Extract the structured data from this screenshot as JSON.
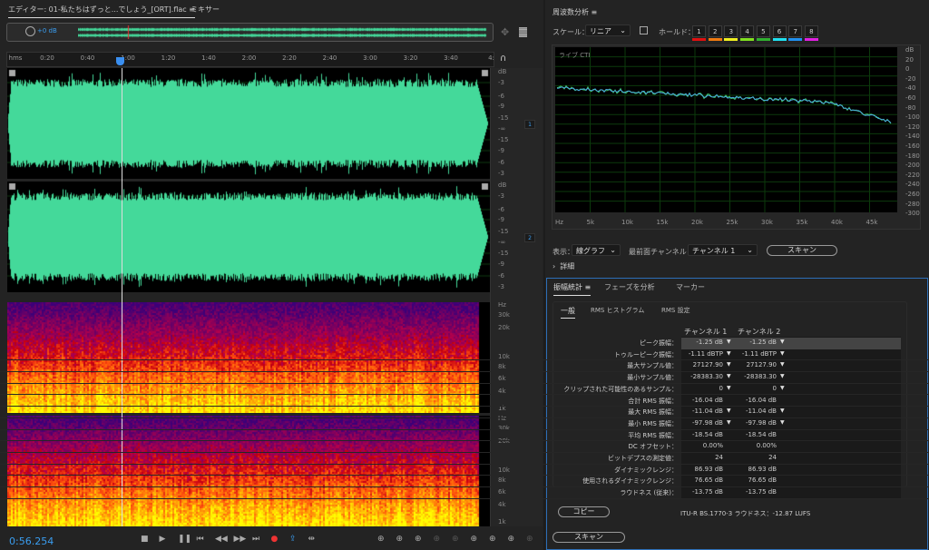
{
  "editor": {
    "tabs": [
      {
        "label": "エディター: 01-私たちはずっと...でしょう_[ORT].flac",
        "active": true
      },
      {
        "label": "ミキサー"
      }
    ],
    "menu_icon": "≡",
    "overview": {
      "gain": "+0 dB"
    },
    "ruler": {
      "unit": "hms",
      "ticks": [
        "0:20",
        "0:40",
        "1:00",
        "1:20",
        "1:40",
        "2:00",
        "2:20",
        "2:40",
        "3:00",
        "3:20",
        "3:40",
        "4:"
      ]
    },
    "playhead_time": "0:56.254",
    "wave_scale": [
      "dB",
      "-3",
      "-6",
      "-9",
      "-15",
      "-∞",
      "-15",
      "-9",
      "-6",
      "-3"
    ],
    "channels": [
      "1",
      "2"
    ],
    "spec_scale": [
      "Hz",
      "30k",
      "20k",
      "10k",
      "8k",
      "6k",
      "4k",
      "1k"
    ],
    "waveform_color": "#44d99a",
    "transport": [
      "stop-icon",
      "play-icon",
      "pause-icon",
      "go-to-start-icon",
      "rewind-icon",
      "fast-forward-icon",
      "go-to-end-icon",
      "record-icon",
      "loop-icon",
      "skip-selection-icon"
    ],
    "zoom_tools": [
      "zoom-in-amplitude-icon",
      "zoom-out-amplitude-icon",
      "zoom-in-time-icon",
      "zoom-out-full-icon",
      "zoom-selection-icon",
      "zoom-in-left-icon",
      "zoom-in-right-icon",
      "zoom-out-both-icon",
      "zoom-reset-icon"
    ]
  },
  "frequency": {
    "title": "周波数分析",
    "scale_label": "スケール：",
    "scale_value": "リニア",
    "hold_label": "ホールド：",
    "holds": [
      {
        "n": "1",
        "color": "#e01010"
      },
      {
        "n": "2",
        "color": "#f07a10"
      },
      {
        "n": "3",
        "color": "#f0f020"
      },
      {
        "n": "4",
        "color": "#80e020"
      },
      {
        "n": "5",
        "color": "#30b030"
      },
      {
        "n": "6",
        "color": "#20e0f0"
      },
      {
        "n": "7",
        "color": "#2090f0"
      },
      {
        "n": "8",
        "color": "#e020e0"
      }
    ],
    "live_label": "ライブ CTI",
    "x_ticks": [
      "Hz",
      "5k",
      "10k",
      "15k",
      "20k",
      "25k",
      "30k",
      "35k",
      "40k",
      "45k"
    ],
    "y_ticks": [
      "dB",
      "20",
      "0",
      "-20",
      "-40",
      "-60",
      "-80",
      "-100",
      "-120",
      "-140",
      "-160",
      "-180",
      "-200",
      "-220",
      "-240",
      "-260",
      "-280",
      "-300"
    ],
    "display_label": "表示：",
    "display_value": "線グラフ",
    "front_label": "最前面チャンネル：",
    "front_value": "チャンネル 1",
    "scan": "スキャン",
    "details": "詳細"
  },
  "stats": {
    "tabs": [
      "振幅統計",
      "フェーズを分析",
      "マーカー"
    ],
    "subtabs": [
      "一般",
      "RMS ヒストグラム",
      "RMS 設定"
    ],
    "headers": [
      "チャンネル 1",
      "チャンネル 2"
    ],
    "rows": [
      {
        "label": "ピーク振幅：",
        "c1": "-1.25 dB",
        "c2": "-1.25 dB",
        "flag": true
      },
      {
        "label": "トゥルーピーク振幅：",
        "c1": "-1.11 dBTP",
        "c2": "-1.11 dBTP",
        "flag": true
      },
      {
        "label": "最大サンプル値：",
        "c1": "27127.90",
        "c2": "27127.90",
        "flag": true
      },
      {
        "label": "最小サンプル値：",
        "c1": "-28383.30",
        "c2": "-28383.30",
        "flag": true
      },
      {
        "label": "クリップされた可能性のあるサンプル：",
        "c1": "0",
        "c2": "0",
        "flag": true
      },
      {
        "label": "合計 RMS 振幅：",
        "c1": "-16.04 dB",
        "c2": "-16.04 dB",
        "flag": false
      },
      {
        "label": "最大 RMS 振幅：",
        "c1": "-11.04 dB",
        "c2": "-11.04 dB",
        "flag": true
      },
      {
        "label": "最小 RMS 振幅：",
        "c1": "-97.98 dB",
        "c2": "-97.98 dB",
        "flag": true
      },
      {
        "label": "平均 RMS 振幅：",
        "c1": "-18.54 dB",
        "c2": "-18.54 dB",
        "flag": false
      },
      {
        "label": "DC オフセット：",
        "c1": "0.00%",
        "c2": "0.00%",
        "flag": false
      },
      {
        "label": "ビットデプスの測定値：",
        "c1": "24",
        "c2": "24",
        "flag": false
      },
      {
        "label": "ダイナミックレンジ：",
        "c1": "86.93 dB",
        "c2": "86.93 dB",
        "flag": false
      },
      {
        "label": "使用されるダイナミックレンジ：",
        "c1": "76.65 dB",
        "c2": "76.65 dB",
        "flag": false
      },
      {
        "label": "ラウドネス (従来)：",
        "c1": "-13.75 dB",
        "c2": "-13.75 dB",
        "flag": false
      }
    ],
    "copy": "コピー",
    "loudness": "ITU-R BS.1770-3 ラウドネス：-12.87 LUFS",
    "scan": "スキャン"
  }
}
